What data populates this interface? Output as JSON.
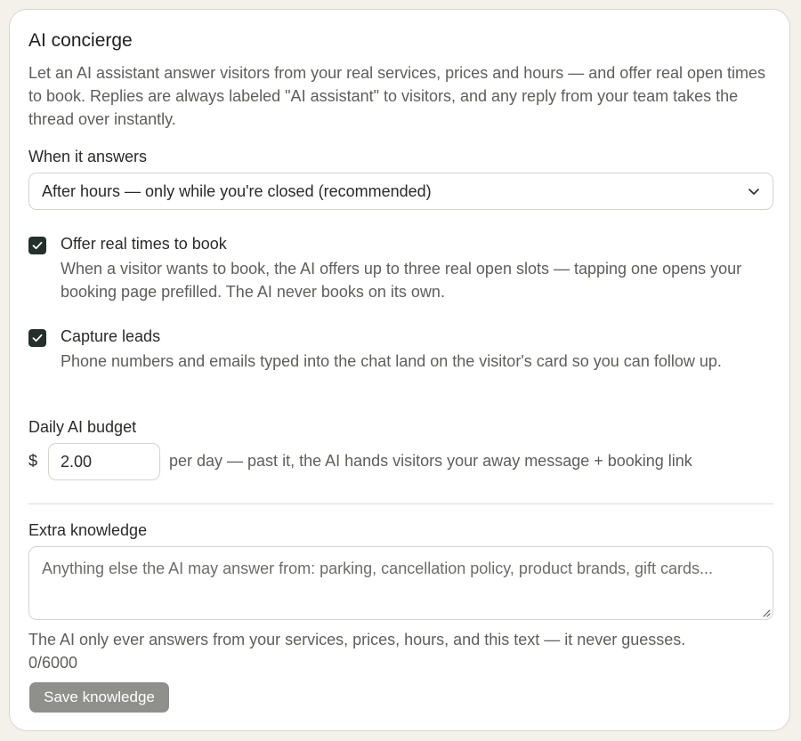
{
  "concierge": {
    "title": "AI concierge",
    "description": "Let an AI assistant answer visitors from your real services, prices and hours — and offer real open times to book. Replies are always labeled \"AI assistant\" to visitors, and any reply from your team takes the thread over instantly."
  },
  "when_answers": {
    "label": "When it answers",
    "selected": "After hours — only while you're closed (recommended)"
  },
  "offer_times": {
    "checked": true,
    "title": "Offer real times to book",
    "description": "When a visitor wants to book, the AI offers up to three real open slots — tapping one opens your booking page prefilled. The AI never books on its own."
  },
  "capture_leads": {
    "checked": true,
    "title": "Capture leads",
    "description": "Phone numbers and emails typed into the chat land on the visitor's card so you can follow up."
  },
  "budget": {
    "label": "Daily AI budget",
    "currency": "$",
    "value": "2.00",
    "hint": "per day — past it, the AI hands visitors your away message + booking link"
  },
  "knowledge": {
    "label": "Extra knowledge",
    "placeholder": "Anything else the AI may answer from: parking, cancellation policy, product brands, gift cards...",
    "note": "The AI only ever answers from your services, prices, hours, and this text — it never guesses.",
    "counter": "0/6000",
    "save_label": "Save knowledge"
  },
  "colors": {
    "checkbox": "#24302b",
    "save_button": "#8f8f8c",
    "card_bg": "#ffffff",
    "page_bg": "#f4f1ea"
  }
}
